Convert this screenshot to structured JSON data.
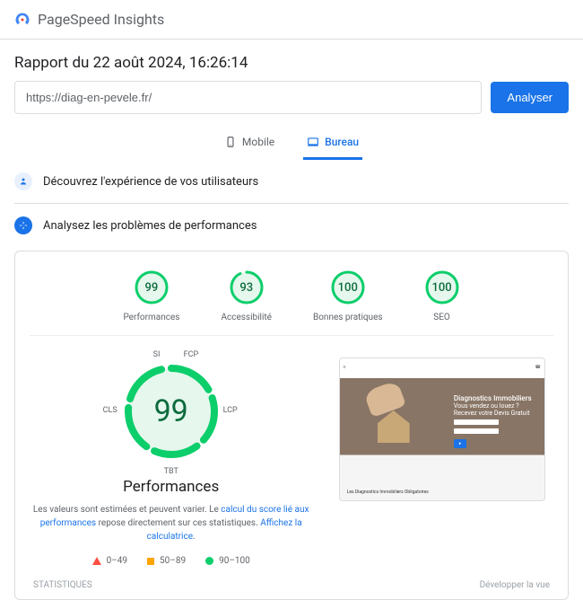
{
  "header": {
    "product": "PageSpeed Insights"
  },
  "report": {
    "title": "Rapport du 22 août 2024, 16:26:14",
    "url": "https://diag-en-pevele.fr/",
    "analyze_label": "Analyser"
  },
  "tabs": {
    "mobile": "Mobile",
    "desktop": "Bureau"
  },
  "sections": {
    "discover": "Découvrez l'expérience de vos utilisateurs",
    "analyze": "Analysez les problèmes de performances"
  },
  "gauges": [
    {
      "score": "99",
      "label": "Performances",
      "pct": 99
    },
    {
      "score": "93",
      "label": "Accessibilité",
      "pct": 93
    },
    {
      "score": "100",
      "label": "Bonnes pratiques",
      "pct": 100
    },
    {
      "score": "100",
      "label": "SEO",
      "pct": 100
    }
  ],
  "perf": {
    "score": "99",
    "title": "Performances",
    "metrics": {
      "si": "SI",
      "fcp": "FCP",
      "lcp": "LCP",
      "tbt": "TBT",
      "cls": "CLS"
    },
    "desc_1": "Les valeurs sont estimées et peuvent varier. Le ",
    "desc_link1": "calcul du score lié aux performances",
    "desc_2": " repose directement sur ces statistiques. ",
    "desc_link2": "Affichez la calculatrice",
    "desc_3": "."
  },
  "legend": {
    "bad": "0–49",
    "mid": "50–89",
    "good": "90–100"
  },
  "screenshot": {
    "brand": "",
    "hero_title": "Diagnostics Immobiliers",
    "hero_sub1": "Vous vendez ou louez ?",
    "hero_sub2": "Recevez votre Devis Gratuit",
    "bottom": "Les Diagnostics Immobiliers Obligatoires"
  },
  "footer": {
    "stats": "STATISTIQUES",
    "expand": "Développer la vue"
  }
}
